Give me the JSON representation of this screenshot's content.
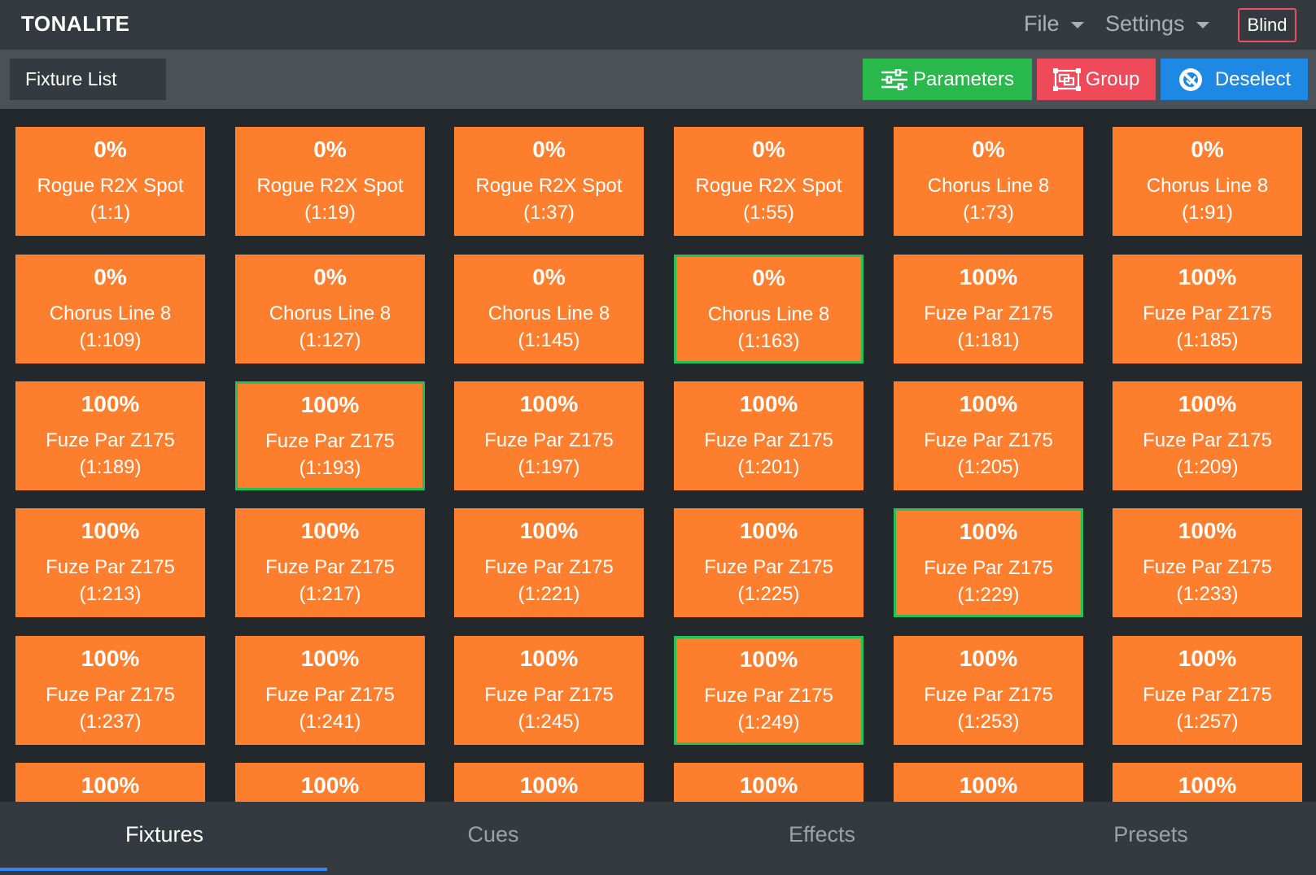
{
  "app": {
    "brand": "TONALITE",
    "menus": {
      "file": "File",
      "settings": "Settings"
    },
    "blind_label": "Blind"
  },
  "toolbar": {
    "fixture_list_label": "Fixture List",
    "parameters_label": "Parameters",
    "group_label": "Group",
    "deselect_label": "Deselect",
    "colors": {
      "parameters": "#28b84c",
      "group": "#ef4a5a",
      "deselect": "#1e88e5"
    }
  },
  "fixtures": [
    {
      "intensity": "0%",
      "name": "Rogue R2X Spot",
      "address": "(1:1)",
      "selected": false
    },
    {
      "intensity": "0%",
      "name": "Rogue R2X Spot",
      "address": "(1:19)",
      "selected": false
    },
    {
      "intensity": "0%",
      "name": "Rogue R2X Spot",
      "address": "(1:37)",
      "selected": false
    },
    {
      "intensity": "0%",
      "name": "Rogue R2X Spot",
      "address": "(1:55)",
      "selected": false
    },
    {
      "intensity": "0%",
      "name": "Chorus Line 8",
      "address": "(1:73)",
      "selected": false
    },
    {
      "intensity": "0%",
      "name": "Chorus Line 8",
      "address": "(1:91)",
      "selected": false
    },
    {
      "intensity": "0%",
      "name": "Chorus Line 8",
      "address": "(1:109)",
      "selected": false
    },
    {
      "intensity": "0%",
      "name": "Chorus Line 8",
      "address": "(1:127)",
      "selected": false
    },
    {
      "intensity": "0%",
      "name": "Chorus Line 8",
      "address": "(1:145)",
      "selected": false
    },
    {
      "intensity": "0%",
      "name": "Chorus Line 8",
      "address": "(1:163)",
      "selected": true
    },
    {
      "intensity": "100%",
      "name": "Fuze Par Z175",
      "address": "(1:181)",
      "selected": false
    },
    {
      "intensity": "100%",
      "name": "Fuze Par Z175",
      "address": "(1:185)",
      "selected": false
    },
    {
      "intensity": "100%",
      "name": "Fuze Par Z175",
      "address": "(1:189)",
      "selected": false
    },
    {
      "intensity": "100%",
      "name": "Fuze Par Z175",
      "address": "(1:193)",
      "selected": true
    },
    {
      "intensity": "100%",
      "name": "Fuze Par Z175",
      "address": "(1:197)",
      "selected": false
    },
    {
      "intensity": "100%",
      "name": "Fuze Par Z175",
      "address": "(1:201)",
      "selected": false
    },
    {
      "intensity": "100%",
      "name": "Fuze Par Z175",
      "address": "(1:205)",
      "selected": false
    },
    {
      "intensity": "100%",
      "name": "Fuze Par Z175",
      "address": "(1:209)",
      "selected": false
    },
    {
      "intensity": "100%",
      "name": "Fuze Par Z175",
      "address": "(1:213)",
      "selected": false
    },
    {
      "intensity": "100%",
      "name": "Fuze Par Z175",
      "address": "(1:217)",
      "selected": false
    },
    {
      "intensity": "100%",
      "name": "Fuze Par Z175",
      "address": "(1:221)",
      "selected": false
    },
    {
      "intensity": "100%",
      "name": "Fuze Par Z175",
      "address": "(1:225)",
      "selected": false
    },
    {
      "intensity": "100%",
      "name": "Fuze Par Z175",
      "address": "(1:229)",
      "selected": true
    },
    {
      "intensity": "100%",
      "name": "Fuze Par Z175",
      "address": "(1:233)",
      "selected": false
    },
    {
      "intensity": "100%",
      "name": "Fuze Par Z175",
      "address": "(1:237)",
      "selected": false
    },
    {
      "intensity": "100%",
      "name": "Fuze Par Z175",
      "address": "(1:241)",
      "selected": false
    },
    {
      "intensity": "100%",
      "name": "Fuze Par Z175",
      "address": "(1:245)",
      "selected": false
    },
    {
      "intensity": "100%",
      "name": "Fuze Par Z175",
      "address": "(1:249)",
      "selected": true
    },
    {
      "intensity": "100%",
      "name": "Fuze Par Z175",
      "address": "(1:253)",
      "selected": false
    },
    {
      "intensity": "100%",
      "name": "Fuze Par Z175",
      "address": "(1:257)",
      "selected": false
    },
    {
      "intensity": "100%",
      "selected": false
    },
    {
      "intensity": "100%",
      "selected": false
    },
    {
      "intensity": "100%",
      "selected": false
    },
    {
      "intensity": "100%",
      "selected": false
    },
    {
      "intensity": "100%",
      "selected": false
    },
    {
      "intensity": "100%",
      "selected": false
    }
  ],
  "tabs": [
    {
      "label": "Fixtures",
      "active": true
    },
    {
      "label": "Cues",
      "active": false
    },
    {
      "label": "Effects",
      "active": false
    },
    {
      "label": "Presets",
      "active": false
    }
  ],
  "colors": {
    "tile": "#fd7f2e",
    "selected_border": "#24c05a",
    "active_tab_underline": "#2f86f6"
  }
}
